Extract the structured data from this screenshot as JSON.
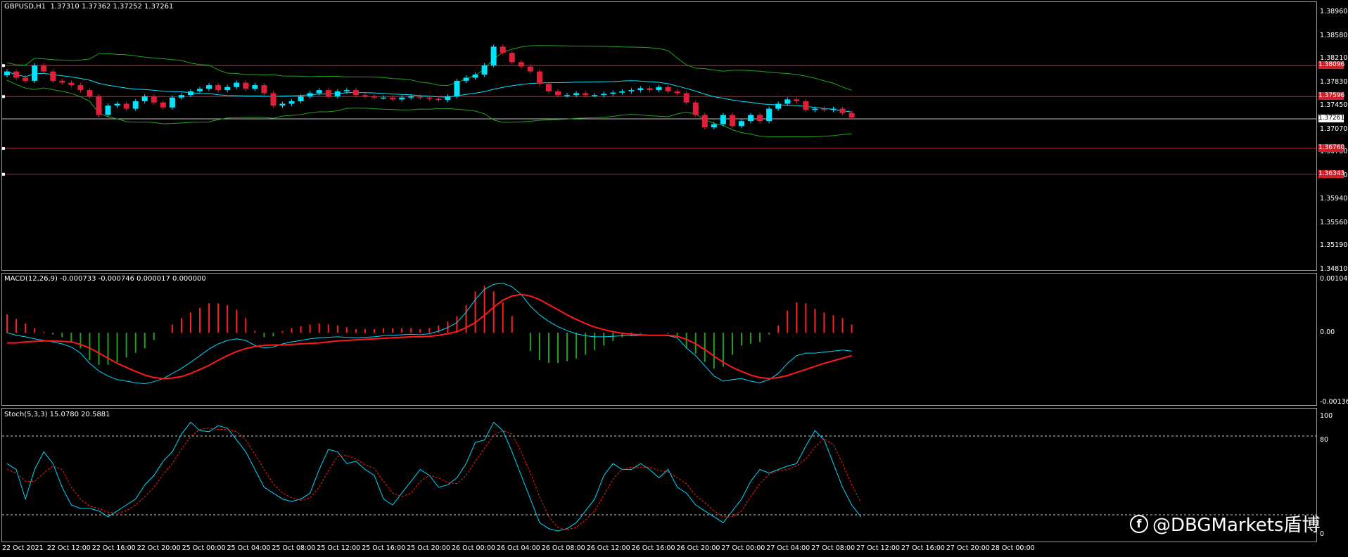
{
  "header": {
    "symbol": "GBPUSD,H1",
    "ohlc": "1.37310 1.37362 1.37252 1.37261"
  },
  "macd_title": "MACD(12,26,9) -0.000733 -0.000746 0.000017 0.000000",
  "stoch_title": "Stoch(5,3,3) 15.0780 20.5881",
  "price_axis_labels": [
    "1.38960",
    "1.38580",
    "1.38210",
    "1.37830",
    "1.37450",
    "1.37070",
    "1.36700",
    "1.36320",
    "1.35940",
    "1.35560",
    "1.35190",
    "1.34810"
  ],
  "macd_axis_labels": [
    "0.001049",
    "0.00",
    "-0.001364"
  ],
  "stoch_axis_labels": [
    "100",
    "80",
    "0"
  ],
  "current_price": "1.37261",
  "levels": [
    {
      "value": 1.38096,
      "label": "1.38096"
    },
    {
      "value": 1.37596,
      "label": "1.37596"
    },
    {
      "value": 1.3676,
      "label": "1.36760"
    },
    {
      "value": 1.36343,
      "label": "1.36343"
    }
  ],
  "time_labels": [
    "22 Oct 2021",
    "22 Oct 12:00",
    "22 Oct 16:00",
    "22 Oct 20:00",
    "25 Oct 00:00",
    "25 Oct 04:00",
    "25 Oct 08:00",
    "25 Oct 12:00",
    "25 Oct 16:00",
    "25 Oct 20:00",
    "26 Oct 00:00",
    "26 Oct 04:00",
    "26 Oct 08:00",
    "26 Oct 12:00",
    "26 Oct 16:00",
    "26 Oct 20:00",
    "27 Oct 00:00",
    "27 Oct 04:00",
    "27 Oct 08:00",
    "27 Oct 12:00",
    "27 Oct 16:00",
    "27 Oct 20:00",
    "28 Oct 00:00"
  ],
  "watermark": "@DBGMarkets盾博",
  "colors": {
    "bull": "#00e5ff",
    "bear": "#e0203a",
    "ma": "#00e5ff",
    "bands": "#1fa31f",
    "macd_signal": "#ff1a1a",
    "macd_line": "#00d8ff",
    "hist_pos": "#ff2020",
    "hist_neg": "#1fa31f",
    "level": "#d0202a",
    "grid_dash": "#c8c8c8"
  },
  "chart_data": [
    {
      "type": "candlestick",
      "title": "GBPUSD,H1",
      "ylim": [
        1.3481,
        1.3896
      ],
      "close": [
        1.38,
        1.379,
        1.3785,
        1.381,
        1.38,
        1.3785,
        1.3782,
        1.3778,
        1.377,
        1.376,
        1.373,
        1.3745,
        1.3748,
        1.374,
        1.3752,
        1.376,
        1.375,
        1.3742,
        1.3758,
        1.3762,
        1.3768,
        1.3772,
        1.3778,
        1.377,
        1.3775,
        1.3782,
        1.3772,
        1.3778,
        1.3765,
        1.3745,
        1.3748,
        1.3752,
        1.376,
        1.3765,
        1.377,
        1.376,
        1.3768,
        1.377,
        1.3762,
        1.376,
        1.3758,
        1.3758,
        1.3755,
        1.3758,
        1.376,
        1.3758,
        1.3756,
        1.3754,
        1.376,
        1.3785,
        1.379,
        1.3795,
        1.381,
        1.384,
        1.383,
        1.3815,
        1.3808,
        1.38,
        1.378,
        1.3768,
        1.3762,
        1.3762,
        1.3765,
        1.3762,
        1.3762,
        1.3764,
        1.3766,
        1.3768,
        1.377,
        1.3773,
        1.377,
        1.3775,
        1.3768,
        1.3765,
        1.375,
        1.373,
        1.371,
        1.3715,
        1.373,
        1.3712,
        1.372,
        1.373,
        1.372,
        1.374,
        1.3748,
        1.3755,
        1.3752,
        1.3738,
        1.374,
        1.3738,
        1.374,
        1.3733,
        1.3726
      ],
      "macd_line": [
        0.0,
        -5e-05,
        -8e-05,
        -0.00012,
        -0.00015,
        -0.00018,
        -0.00022,
        -0.00028,
        -0.0004,
        -0.0006,
        -0.00075,
        -0.00085,
        -0.00092,
        -0.00095,
        -0.00098,
        -0.001,
        -0.00096,
        -0.0009,
        -0.0008,
        -0.0007,
        -0.00058,
        -0.00045,
        -0.00032,
        -0.00022,
        -0.00015,
        -0.00012,
        -0.00015,
        -0.00025,
        -0.0003,
        -0.00028,
        -0.00022,
        -0.00018,
        -0.00015,
        -0.00012,
        -0.0001,
        -9e-05,
        -8e-05,
        -9e-05,
        -0.0001,
        -9e-05,
        -8e-05,
        -6e-05,
        -5e-05,
        -4e-05,
        -3e-05,
        -4e-05,
        -2e-05,
        3e-05,
        0.0001,
        0.0002,
        0.0004,
        0.00065,
        0.00085,
        0.00095,
        0.00097,
        0.0009,
        0.00075,
        0.00052,
        0.00035,
        0.00022,
        0.00012,
        4e-05,
        -2e-05,
        -6e-05,
        -8e-05,
        -8e-05,
        -7e-05,
        -6e-05,
        -6e-05,
        -5e-05,
        -5e-05,
        -5e-05,
        -6e-05,
        -0.0001,
        -0.0003,
        -0.00045,
        -0.00065,
        -0.00085,
        -0.00095,
        -0.00092,
        -0.0009,
        -0.00095,
        -0.00098,
        -0.00092,
        -0.0008,
        -0.0006,
        -0.00045,
        -0.0004,
        -0.0004,
        -0.00038,
        -0.00036,
        -0.00034,
        -0.00036
      ],
      "macd_signal": [
        -0.0002,
        -0.0002,
        -0.00018,
        -0.00017,
        -0.00016,
        -0.00016,
        -0.00017,
        -0.00018,
        -0.00023,
        -0.0003,
        -0.0004,
        -0.0005,
        -0.0006,
        -0.00068,
        -0.00076,
        -0.00083,
        -0.00088,
        -0.0009,
        -0.00089,
        -0.00086,
        -0.0008,
        -0.00072,
        -0.00064,
        -0.00054,
        -0.00045,
        -0.00037,
        -0.00031,
        -0.00027,
        -0.00025,
        -0.00024,
        -0.00024,
        -0.00023,
        -0.00022,
        -0.00021,
        -0.0002,
        -0.00018,
        -0.00016,
        -0.00015,
        -0.00014,
        -0.00013,
        -0.00012,
        -0.00011,
        -0.0001,
        -9e-05,
        -8e-05,
        -8e-05,
        -7e-05,
        -5e-05,
        -2e-05,
        2e-05,
        0.0001,
        0.0002,
        0.00034,
        0.0005,
        0.00064,
        0.00072,
        0.00075,
        0.00072,
        0.00065,
        0.00055,
        0.00045,
        0.00035,
        0.00026,
        0.00018,
        0.00011,
        6e-05,
        2e-05,
        -1e-05,
        -3e-05,
        -4e-05,
        -5e-05,
        -5e-05,
        -5e-05,
        -7e-05,
        -0.00013,
        -0.00022,
        -0.00033,
        -0.00046,
        -0.00058,
        -0.00068,
        -0.00076,
        -0.00083,
        -0.00088,
        -0.0009,
        -0.00088,
        -0.00084,
        -0.00078,
        -0.00072,
        -0.00066,
        -0.0006,
        -0.00055,
        -0.0005,
        -0.00045
      ],
      "stoch_main": [
        60,
        55,
        30,
        55,
        70,
        60,
        40,
        25,
        22,
        22,
        20,
        15,
        20,
        25,
        30,
        42,
        50,
        62,
        70,
        85,
        95,
        88,
        87,
        92,
        90,
        80,
        70,
        55,
        40,
        35,
        30,
        28,
        30,
        35,
        55,
        72,
        70,
        60,
        62,
        55,
        50,
        30,
        25,
        35,
        45,
        55,
        50,
        40,
        42,
        48,
        60,
        78,
        80,
        95,
        88,
        70,
        50,
        30,
        10,
        5,
        3,
        5,
        10,
        20,
        30,
        50,
        60,
        55,
        55,
        60,
        55,
        48,
        55,
        40,
        35,
        25,
        20,
        15,
        10,
        20,
        30,
        45,
        55,
        52,
        55,
        58,
        60,
        75,
        88,
        80,
        60,
        40,
        25,
        15
      ],
      "stoch_signal": [
        55,
        52,
        45,
        45,
        52,
        58,
        55,
        40,
        30,
        24,
        22,
        19,
        18,
        20,
        25,
        32,
        40,
        51,
        60,
        72,
        83,
        89,
        90,
        89,
        89,
        87,
        80,
        68,
        55,
        43,
        35,
        31,
        29,
        31,
        40,
        54,
        66,
        67,
        64,
        59,
        56,
        45,
        35,
        32,
        35,
        45,
        50,
        48,
        44,
        43,
        50,
        62,
        73,
        84,
        88,
        85,
        70,
        52,
        32,
        15,
        6,
        4,
        6,
        12,
        20,
        33,
        47,
        55,
        57,
        57,
        57,
        54,
        53,
        48,
        43,
        33,
        27,
        20,
        15,
        15,
        20,
        32,
        43,
        51,
        54,
        55,
        58,
        64,
        74,
        81,
        76,
        60,
        42,
        27
      ]
    }
  ]
}
